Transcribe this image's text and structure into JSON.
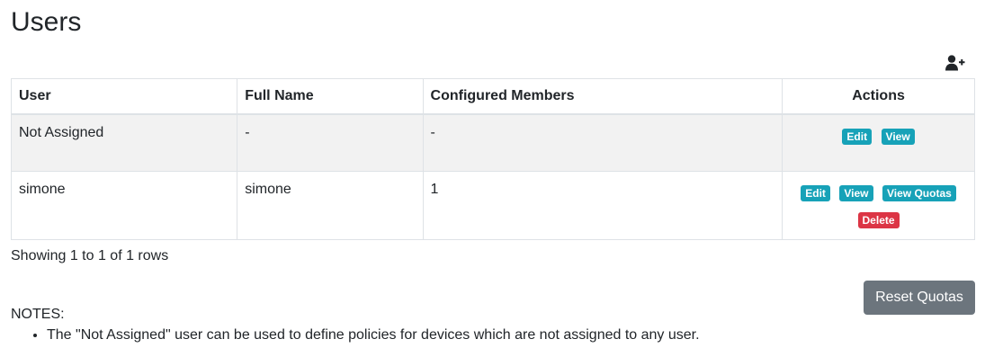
{
  "page": {
    "title": "Users"
  },
  "toolbar": {
    "add_user_icon": "user-plus-icon"
  },
  "table": {
    "headers": {
      "user": "User",
      "full_name": "Full Name",
      "configured_members": "Configured Members",
      "actions": "Actions"
    },
    "rows": [
      {
        "user": "Not Assigned",
        "full_name": "-",
        "configured_members": "-",
        "actions": {
          "edit": "Edit",
          "view": "View"
        }
      },
      {
        "user": "simone",
        "full_name": "simone",
        "configured_members": "1",
        "actions": {
          "edit": "Edit",
          "view": "View",
          "view_quotas": "View Quotas",
          "delete": "Delete"
        }
      }
    ]
  },
  "pagination": {
    "info": "Showing 1 to 1 of 1 rows"
  },
  "buttons": {
    "reset_quotas": "Reset Quotas"
  },
  "notes": {
    "label": "NOTES:",
    "items": [
      "The \"Not Assigned\" user can be used to define policies for devices which are not assigned to any user."
    ]
  },
  "colors": {
    "info_badge": "#17a2b8",
    "danger_badge": "#dc3545",
    "secondary_button": "#6c757d",
    "striped_row": "#f2f2f2"
  }
}
